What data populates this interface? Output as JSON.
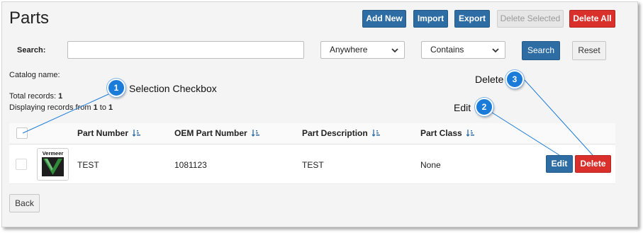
{
  "page": {
    "title": "Parts"
  },
  "toolbar": {
    "add_new": "Add New",
    "import": "Import",
    "export": "Export",
    "delete_selected": "Delete Selected",
    "delete_all": "Delete All"
  },
  "search": {
    "label": "Search:",
    "value": "",
    "scope": "Anywhere",
    "match": "Contains",
    "search_button": "Search",
    "reset_button": "Reset"
  },
  "info": {
    "catalog_label": "Catalog name:",
    "total_label": "Total records:",
    "total_value": "1",
    "displaying_prefix": "Displaying records from",
    "displaying_from": "1",
    "displaying_to_word": "to",
    "displaying_to": "1"
  },
  "table": {
    "columns": [
      "Part Number",
      "OEM Part Number",
      "Part Description",
      "Part Class"
    ],
    "rows": [
      {
        "thumbnail_brand": "Vermeer",
        "part_number": "TEST",
        "oem_part_number": "1081123",
        "part_description": "TEST",
        "part_class": "None",
        "edit_label": "Edit",
        "delete_label": "Delete"
      }
    ]
  },
  "footer": {
    "back": "Back"
  },
  "callouts": [
    {
      "number": "1",
      "label": "Selection Checkbox"
    },
    {
      "number": "2",
      "label": "Edit"
    },
    {
      "number": "3",
      "label": "Delete"
    }
  ],
  "colors": {
    "primary": "#2e6da4",
    "danger": "#d9302c",
    "callout": "#1b7bd9",
    "callout_line": "#1b7bd9",
    "vermeer_green": "#2f8a3a"
  },
  "icons": {
    "sort": "sort-ascending-icon",
    "dropdown": "chevron-down-icon"
  }
}
